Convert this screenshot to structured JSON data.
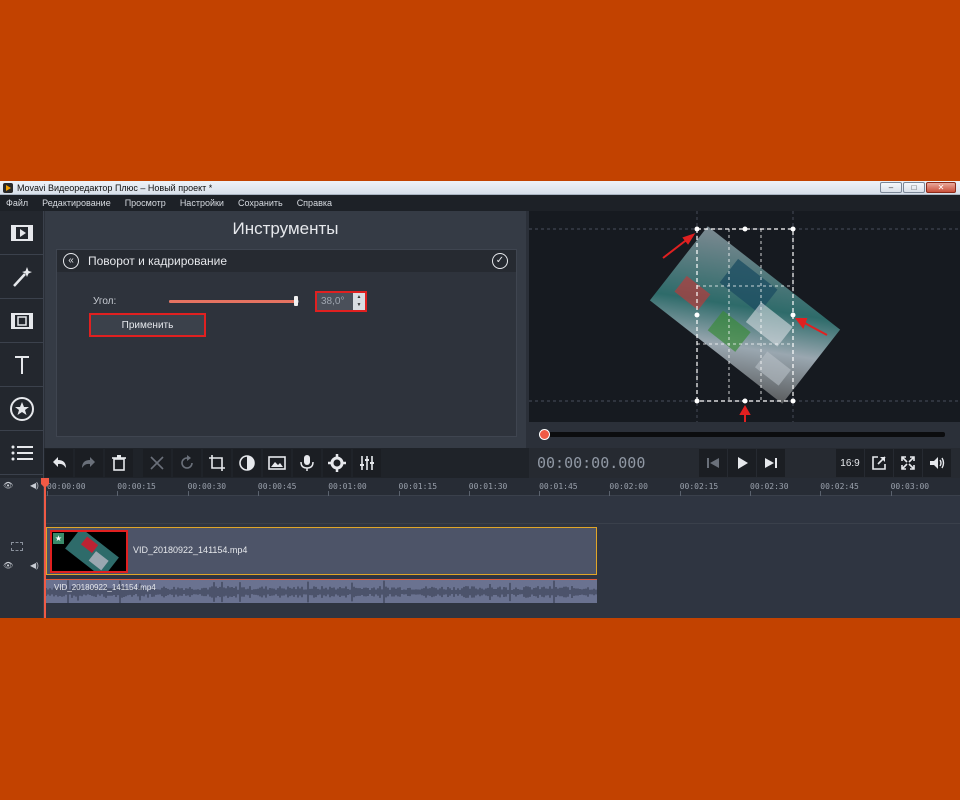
{
  "window": {
    "title": "Movavi Видеоредактор Плюс – Новый проект *",
    "buttons": [
      "–",
      "□",
      "✕"
    ]
  },
  "menu": [
    "Файл",
    "Редактирование",
    "Просмотр",
    "Настройки",
    "Сохранить",
    "Справка"
  ],
  "rail": {
    "items": [
      {
        "name": "import-media",
        "icon": "film-strip-icon"
      },
      {
        "name": "filters",
        "icon": "magic-wand-icon"
      },
      {
        "name": "transitions",
        "icon": "transition-icon"
      },
      {
        "name": "titles",
        "icon": "text-icon"
      },
      {
        "name": "stickers",
        "icon": "star-badge-icon"
      },
      {
        "name": "more-tools",
        "icon": "list-icon"
      }
    ]
  },
  "tools": {
    "title": "Инструменты",
    "tool_name": "Поворот и кадрирование",
    "angle_label": "Угол:",
    "angle_value": "38,0°",
    "angle_slider_fraction": 0.98,
    "apply_label": "Применить"
  },
  "player": {
    "timecode": "00:00:00.000",
    "aspect": "16:9"
  },
  "timeline": {
    "ticks": [
      "00:00:00",
      "00:00:15",
      "00:00:30",
      "00:00:45",
      "00:01:00",
      "00:01:15",
      "00:01:30",
      "00:01:45",
      "00:02:00",
      "00:02:15",
      "00:02:30",
      "00:02:45",
      "00:03:00"
    ],
    "video_clip_name": "VID_20180922_141154.mp4",
    "audio_clip_name": "VID_20180922_141154.mp4"
  },
  "colors": {
    "accent": "#f05a45",
    "highlight_box": "#e02020",
    "clip_border": "#e0a628",
    "background": "#c24200"
  }
}
